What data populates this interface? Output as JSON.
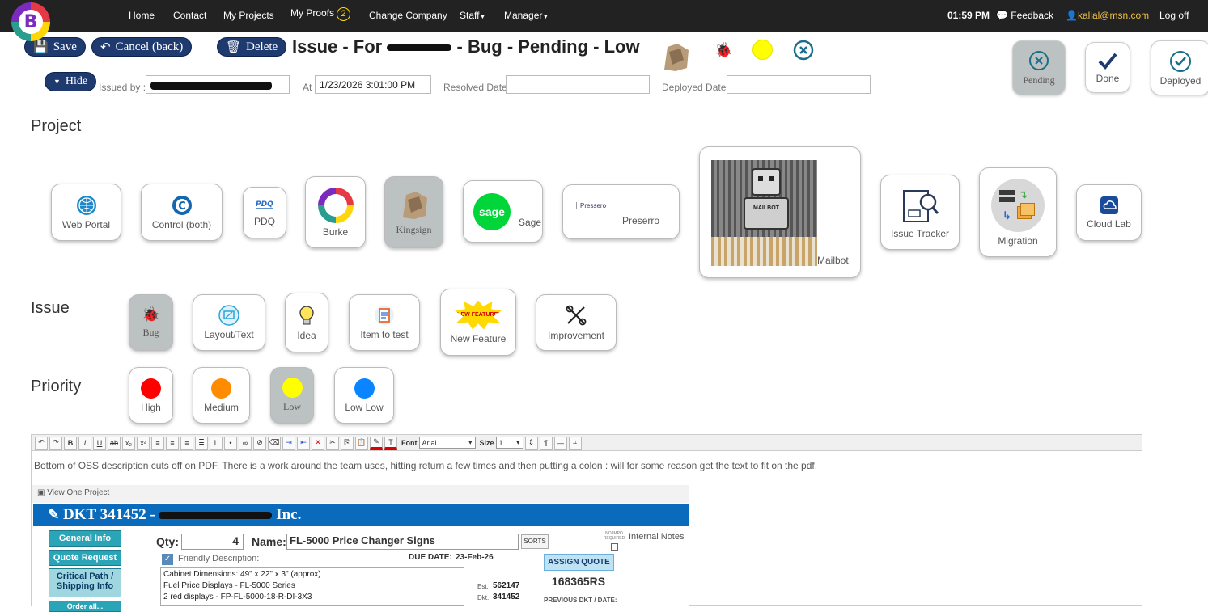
{
  "nav": {
    "items": [
      "Home",
      "Contact",
      "My Projects",
      "My Proofs",
      "Change Company",
      "Staff",
      "Manager"
    ],
    "proofs_badge": "2",
    "time": "01:59 PM",
    "feedback": "Feedback",
    "user": "kallal@msn.com",
    "logoff": "Log off",
    "logo_letter": "B"
  },
  "toolbar": {
    "save": "Save",
    "cancel": "Cancel (back)",
    "delete": "Delete"
  },
  "title": {
    "prefix": "Issue - For",
    "suffix": "- Bug - Pending - Low"
  },
  "meta": {
    "hide": "Hide",
    "issued_by_label": "Issued by :",
    "at_label": "At",
    "at_value": "1/23/2026 3:01:00 PM",
    "resolved_label": "Resolved Date",
    "resolved_value": "",
    "deployed_label": "Deployed Date",
    "deployed_value": ""
  },
  "status_buttons": [
    {
      "label": "Pending",
      "icon": "x-circle-icon",
      "active": true
    },
    {
      "label": "Done",
      "icon": "check-icon",
      "active": false
    },
    {
      "label": "Deployed",
      "icon": "check-circle-icon",
      "active": false
    }
  ],
  "sections": {
    "project": "Project",
    "issue": "Issue",
    "priority": "Priority"
  },
  "projects": [
    {
      "label": "Web Portal",
      "icon": "globe-icon"
    },
    {
      "label": "Control (both)",
      "icon": "c-logo-icon"
    },
    {
      "label": "PDQ",
      "icon": "pdq-logo-icon"
    },
    {
      "label": "Burke",
      "icon": "burke-logo-icon"
    },
    {
      "label": "Kingsign",
      "icon": "lion-logo-icon",
      "active": true
    },
    {
      "label": "Sage",
      "icon": "sage-logo-icon",
      "logo_text": "sage"
    },
    {
      "label": "Preserro",
      "icon": "pressero-logo-icon",
      "logo_text": "Pressero"
    },
    {
      "label": "Mailbot",
      "icon": "robot-image-icon",
      "logo_text": "MAILBOT"
    },
    {
      "label": "Issue Tracker",
      "icon": "issue-tracker-icon"
    },
    {
      "label": "Migration",
      "icon": "migration-icon"
    },
    {
      "label": "Cloud Lab",
      "icon": "cloud-icon"
    }
  ],
  "issue_types": [
    {
      "label": "Bug",
      "icon": "bug-icon",
      "active": true
    },
    {
      "label": "Layout/Text",
      "icon": "layout-icon"
    },
    {
      "label": "Idea",
      "icon": "lightbulb-icon"
    },
    {
      "label": "Item to test",
      "icon": "clipboard-icon"
    },
    {
      "label": "New Feature",
      "icon": "new-feature-icon",
      "logo_text": "NEW FEATURE!"
    },
    {
      "label": "Improvement",
      "icon": "tools-icon"
    }
  ],
  "priorities": [
    {
      "label": "High",
      "color": "#ff0000"
    },
    {
      "label": "Medium",
      "color": "#ff8c00"
    },
    {
      "label": "Low",
      "color": "#ffff00",
      "active": true
    },
    {
      "label": "Low Low",
      "color": "#0a84ff"
    }
  ],
  "editor": {
    "font_label": "Font",
    "font_value": "Arial",
    "size_label": "Size",
    "size_value": "1",
    "description": "Bottom of OSS description cuts off on PDF. There is a work around the team uses, hitting return a few times and then putting a colon : will for some reason get the text to fit on the pdf."
  },
  "embed": {
    "window_title": "View One Project",
    "header_prefix": "DKT 341452 -",
    "header_suffix": "Inc.",
    "side_buttons": [
      "General Info",
      "Quote Request",
      "Critical Path / Shipping Info",
      "Order all..."
    ],
    "qty_label": "Qty:",
    "qty_value": "4",
    "name_label": "Name:",
    "name_value": "FL-5000 Price Changer Signs",
    "sorts": "SORTS",
    "no_impo": "NO IMPO REQUIRED",
    "internal_notes": "Internal Notes",
    "friendly_label": "Friendly Description:",
    "due_label": "DUE DATE:",
    "due_value": "23-Feb-26",
    "assign_quote": "ASSIGN QUOTE",
    "quote_number": "168365RS",
    "desc_lines": [
      "Cabinet Dimensions: 49\" x 22\" x 3\" (approx)",
      "Fuel Price Displays - FL-5000 Series",
      "2 red displays - FP-FL-5000-18-R-DI-3X3"
    ],
    "est_label": "Est.",
    "est_value": "562147",
    "dkt_label": "Dkt.",
    "dkt_value": "341452",
    "previous": "PREVIOUS DKT / DATE:"
  }
}
